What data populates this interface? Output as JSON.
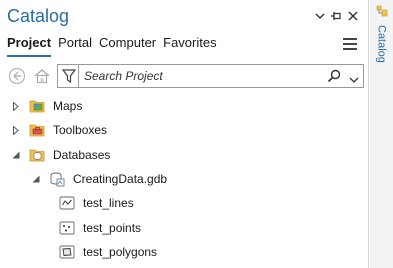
{
  "pane": {
    "title": "Catalog",
    "tabs": [
      {
        "label": "Project",
        "active": true
      },
      {
        "label": "Portal",
        "active": false
      },
      {
        "label": "Computer",
        "active": false
      },
      {
        "label": "Favorites",
        "active": false
      }
    ]
  },
  "search": {
    "placeholder": "Search Project"
  },
  "tree": [
    {
      "label": "Maps",
      "icon": "maps-folder-icon",
      "expanded": false
    },
    {
      "label": "Toolboxes",
      "icon": "toolboxes-folder-icon",
      "expanded": false
    },
    {
      "label": "Databases",
      "icon": "databases-folder-icon",
      "expanded": true
    },
    {
      "label": "CreatingData.gdb",
      "icon": "geodatabase-icon",
      "expanded": true
    },
    {
      "label": "test_lines",
      "icon": "line-feature-class-icon"
    },
    {
      "label": "test_points",
      "icon": "point-feature-class-icon"
    },
    {
      "label": "test_polygons",
      "icon": "polygon-feature-class-icon"
    }
  ],
  "sidebar": {
    "tab_label": "Catalog"
  },
  "colors": {
    "accent": "#2b6ca3",
    "folder": "#f2c14e"
  }
}
